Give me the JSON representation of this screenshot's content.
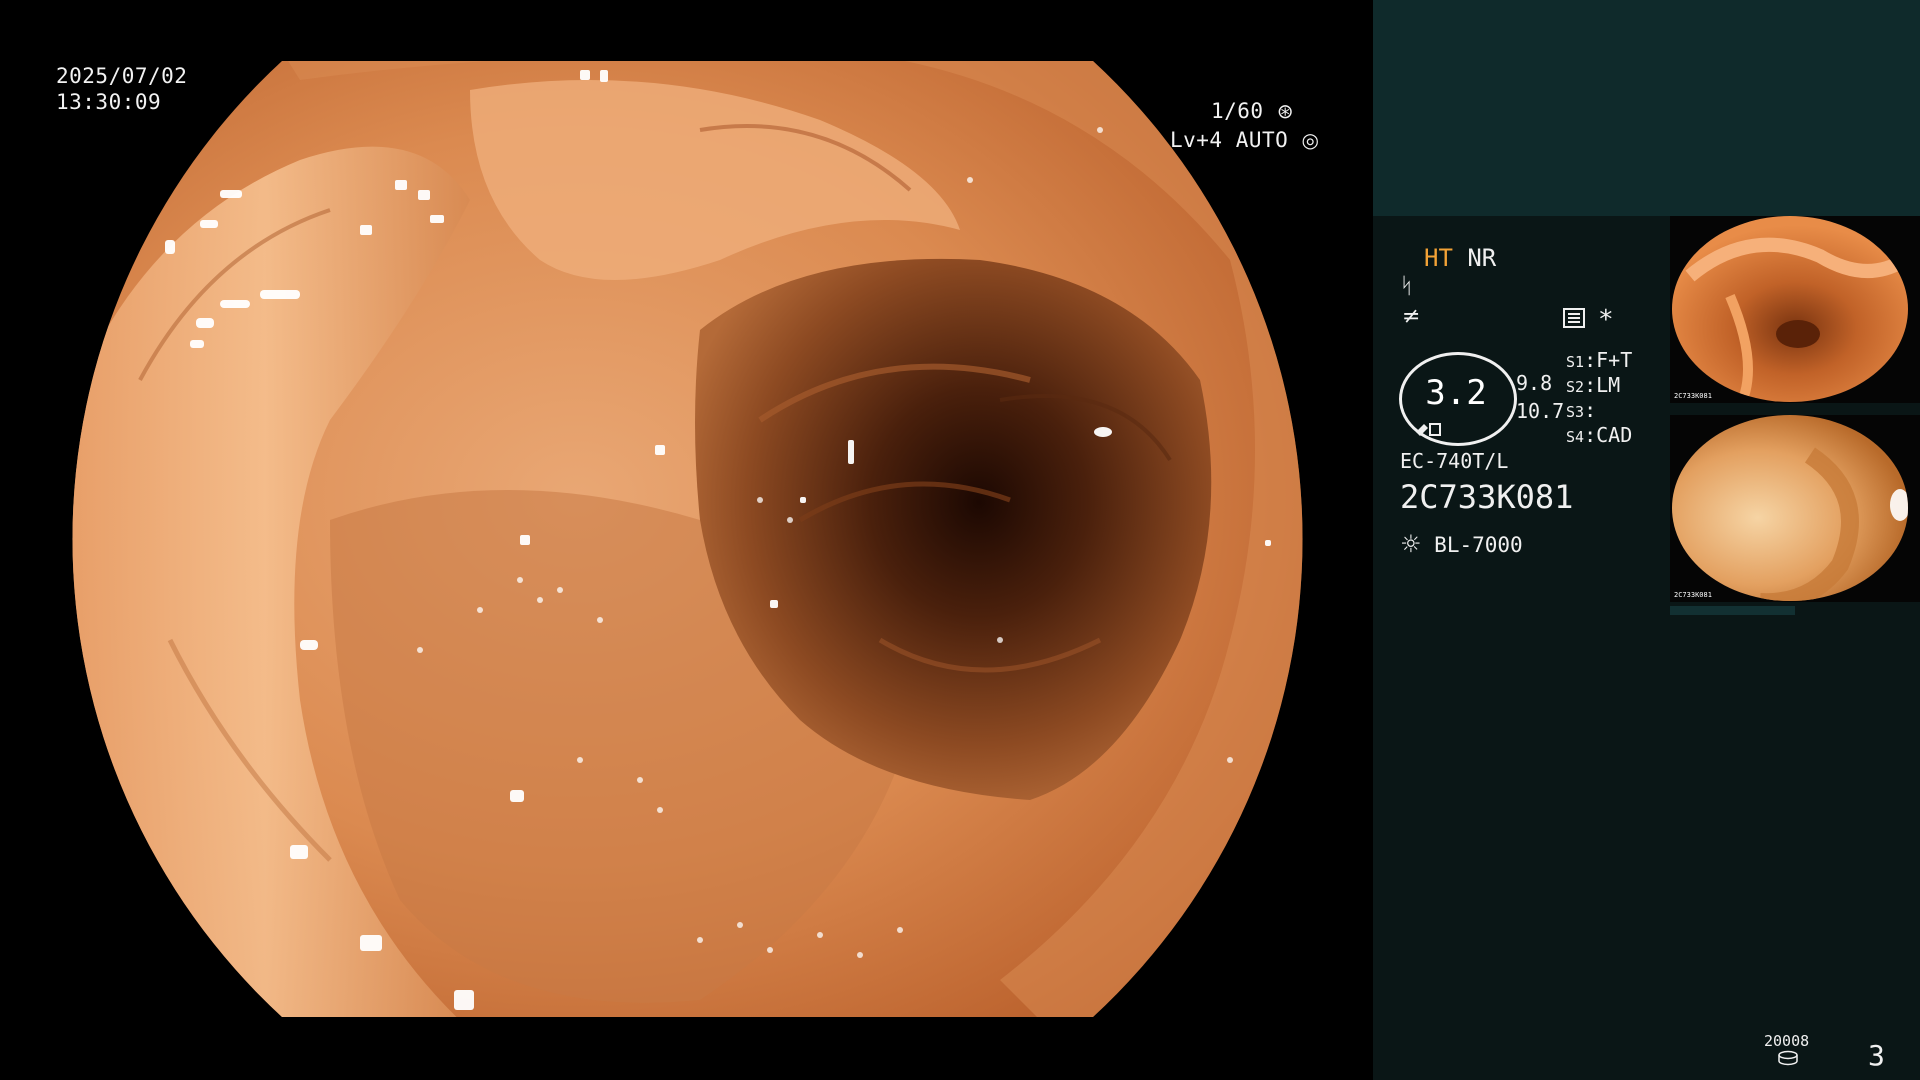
{
  "osd": {
    "date": "2025/07/02",
    "time": "13:30:09",
    "shutter": "1/60",
    "shutter_icon": "aperture-icon",
    "level": "Lv+4",
    "iris": "AUTO",
    "iris_icon": "iris-icon"
  },
  "panel": {
    "ht": "HT",
    "nr": "NR",
    "mode_icons": [
      "structure-enhance-icon",
      "color-enhance-icon",
      "settings-panel-icon"
    ],
    "asterisk": "*",
    "zoom": "3.2",
    "readout_1": "9.8",
    "readout_2": "10.7",
    "switches": [
      {
        "key": "S1",
        "value": "F+T"
      },
      {
        "key": "S2",
        "value": "LM"
      },
      {
        "key": "S3",
        "value": ""
      },
      {
        "key": "S4",
        "value": "CAD"
      }
    ],
    "scope_model": "EC-740T/L",
    "serial": "2C733K081",
    "light_source": "BL-7000",
    "light_icon": "light-source-icon",
    "storage_count": "20008",
    "storage_icon": "storage-disk-icon",
    "page_number": "3"
  },
  "thumbnails": [
    {
      "label": "captured-image-1",
      "caption": "2C733K081"
    },
    {
      "label": "captured-image-2",
      "caption": "2C733K081"
    }
  ],
  "colors": {
    "tissue_light": "#f3b685",
    "tissue_mid": "#d8844a",
    "tissue_dark": "#6a3214",
    "lumen": "#2a0f05",
    "accent_orange": "#f3a236",
    "panel_top": "#0f2a2b",
    "panel_bg": "#0a1616"
  }
}
